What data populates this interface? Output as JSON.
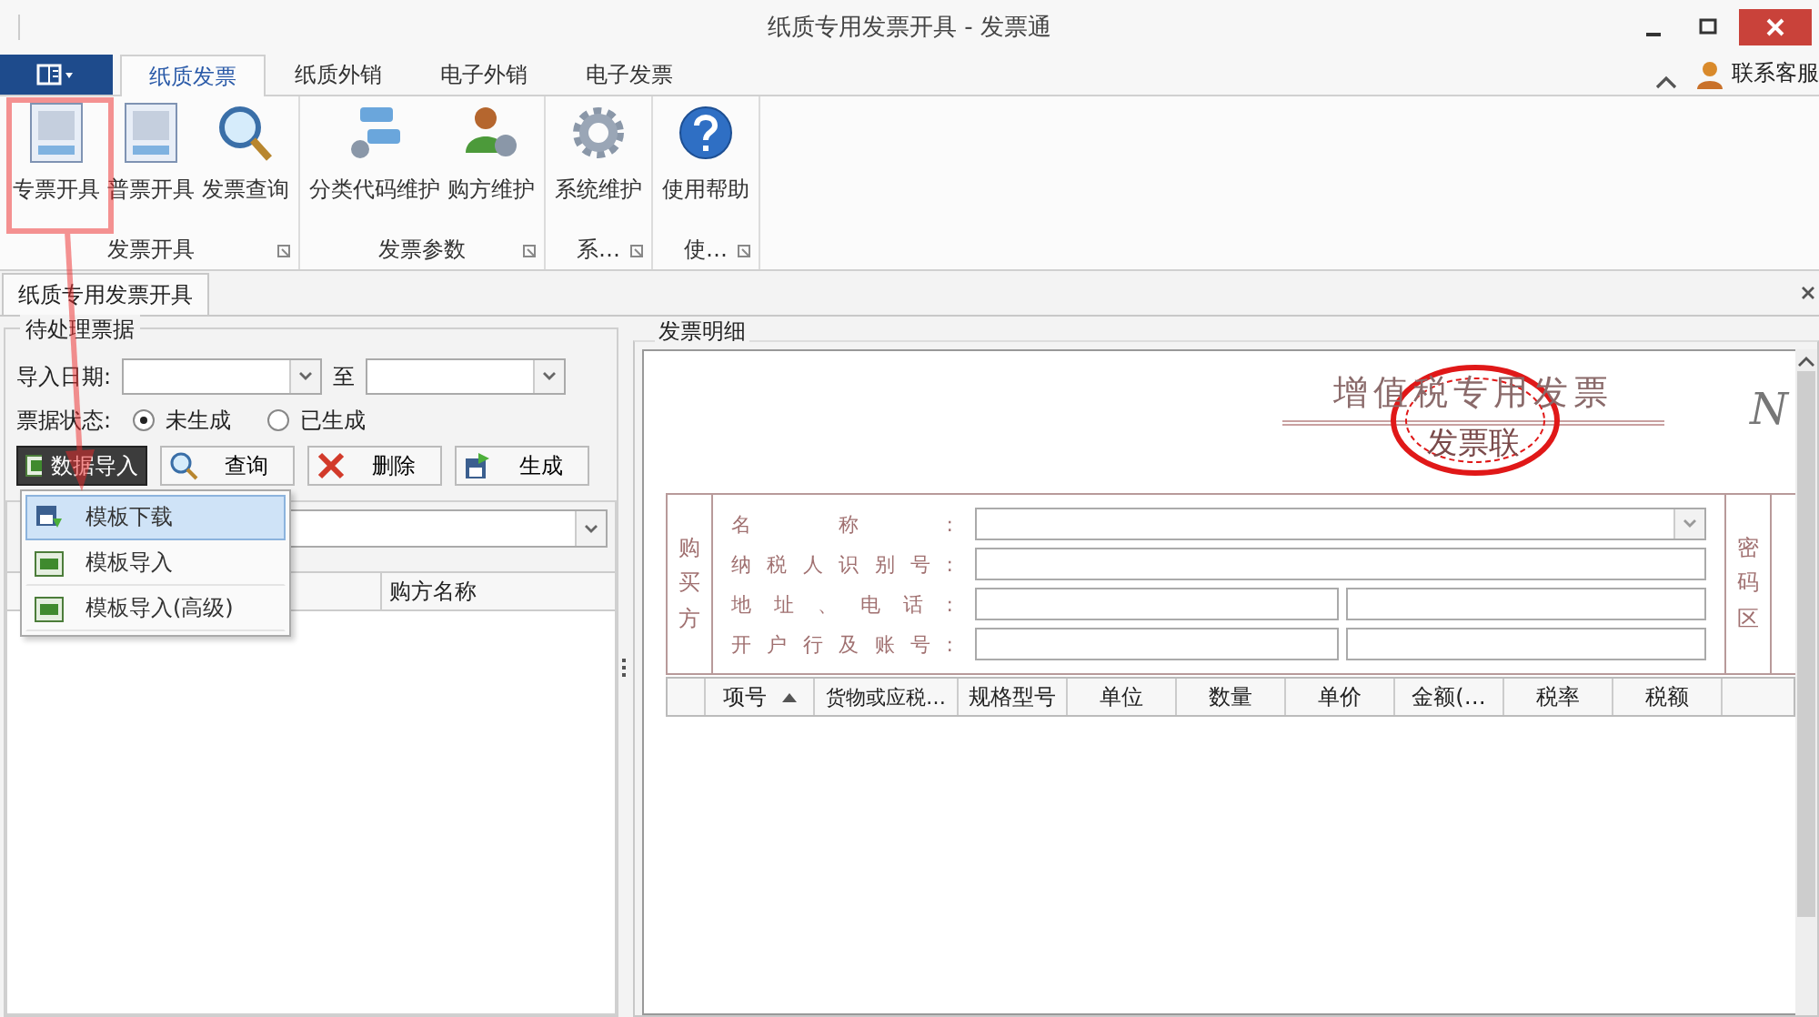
{
  "window": {
    "title": "纸质专用发票开具 - 发票通"
  },
  "ribbon": {
    "tabs": [
      {
        "label": "纸质发票",
        "selected": true
      },
      {
        "label": "纸质外销",
        "selected": false
      },
      {
        "label": "电子外销",
        "selected": false
      },
      {
        "label": "电子发票",
        "selected": false
      }
    ],
    "support_label": "联系客服",
    "groups": [
      {
        "label": "发票开具",
        "items": [
          {
            "label": "专票开具",
            "kind": "invoice"
          },
          {
            "label": "普票开具",
            "kind": "invoice"
          },
          {
            "label": "发票查询",
            "kind": "search"
          }
        ]
      },
      {
        "label": "发票参数",
        "items": [
          {
            "label": "分类代码维护",
            "kind": "network"
          },
          {
            "label": "购方维护",
            "kind": "users"
          }
        ]
      },
      {
        "label": "系…",
        "items": [
          {
            "label": "系统维护",
            "kind": "gear"
          }
        ]
      },
      {
        "label": "使…",
        "items": [
          {
            "label": "使用帮助",
            "kind": "help"
          }
        ]
      }
    ]
  },
  "document_tabs": [
    {
      "label": "纸质专用发票开具",
      "selected": true
    }
  ],
  "pending_panel": {
    "title": "待处理票据",
    "date_label": "导入日期:",
    "to_label": "至",
    "status_label": "票据状态:",
    "status_options": [
      {
        "label": "未生成",
        "selected": true
      },
      {
        "label": "已生成",
        "selected": false
      }
    ],
    "buttons": [
      {
        "label": "数据导入",
        "kind": "import",
        "pressed": true
      },
      {
        "label": "查询",
        "kind": "search",
        "pressed": false
      },
      {
        "label": "删除",
        "kind": "delete",
        "pressed": false
      },
      {
        "label": "生成",
        "kind": "generate",
        "pressed": false
      }
    ],
    "menu": [
      {
        "label": "模板下载",
        "kind": "download",
        "selected": true
      },
      {
        "label": "模板导入",
        "kind": "import",
        "selected": false
      },
      {
        "label": "模板导入(高级)",
        "kind": "import",
        "selected": false
      }
    ],
    "column": "购方名称"
  },
  "invoice_panel": {
    "title": "发票明细",
    "invoice_title": "增值税专用发票",
    "copy_label": "发票联",
    "number_label": "N",
    "buyer_label": "购买方",
    "fields": [
      {
        "label": "名称:",
        "kind": "dropdown"
      },
      {
        "label": "纳税人识别号:",
        "kind": "single"
      },
      {
        "label": "地址、电话:",
        "kind": "split"
      },
      {
        "label": "开户行及账号:",
        "kind": "split"
      }
    ],
    "cipher_label": "密码区",
    "columns": [
      {
        "label": "项号",
        "sorted": true
      },
      {
        "label": "货物或应税…",
        "sorted": false
      },
      {
        "label": "规格型号",
        "sorted": false
      },
      {
        "label": "单位",
        "sorted": false
      },
      {
        "label": "数量",
        "sorted": false
      },
      {
        "label": "单价",
        "sorted": false
      },
      {
        "label": "金额(…",
        "sorted": false
      },
      {
        "label": "税率",
        "sorted": false
      },
      {
        "label": "税额",
        "sorted": false
      }
    ]
  }
}
